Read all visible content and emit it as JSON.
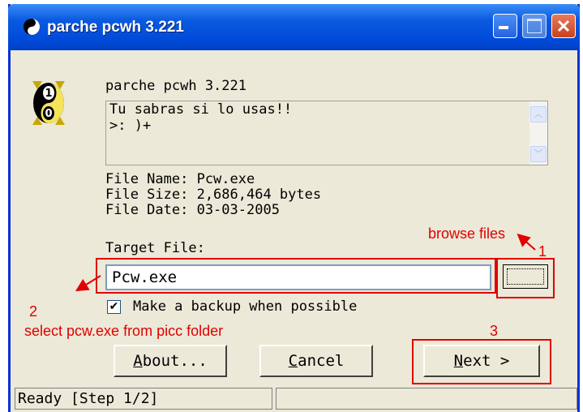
{
  "window": {
    "title": "parche pcwh 3.221",
    "controls": {
      "minimize_icon": "minimize-icon",
      "maximize_icon": "maximize-icon",
      "close_icon": "close-icon"
    }
  },
  "header": {
    "app_name": "parche pcwh 3.221",
    "description_lines": [
      "Tu sabras si lo usas!!",
      ">: )+"
    ]
  },
  "file_info": {
    "name": "File Name: Pcw.exe",
    "size": "File Size: 2,686,464 bytes",
    "date": "File Date: 03-03-2005"
  },
  "target": {
    "label": "Target File:",
    "value": "Pcw.exe",
    "browse_icon": "browse-icon"
  },
  "backup": {
    "checked": true,
    "label": "Make a backup when possible"
  },
  "buttons": {
    "about": {
      "mnemonic": "A",
      "rest": "bout..."
    },
    "cancel": {
      "mnemonic": "C",
      "rest": "ancel"
    },
    "next": {
      "mnemonic": "N",
      "rest": "ext >"
    }
  },
  "status": {
    "text": "Ready [Step 1/2]",
    "secondary": ""
  },
  "annotations": {
    "browse": "browse files",
    "step1": "1",
    "step2": "2",
    "step2_text": "select pcw.exe from picc folder",
    "step3": "3",
    "color": "#e00000"
  }
}
